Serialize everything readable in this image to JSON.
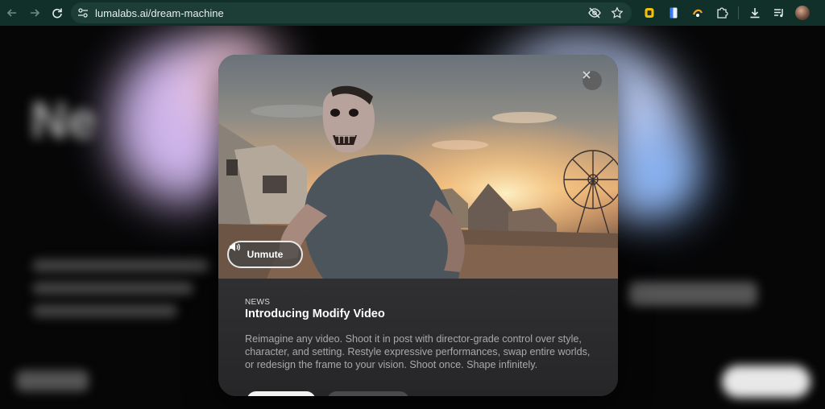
{
  "browser": {
    "url": "lumalabs.ai/dream-machine",
    "icons": [
      "back-icon",
      "forward-icon",
      "reload-icon",
      "site-info-icon",
      "eye-off-icon",
      "star-icon",
      "extension-icon",
      "puzzle-icon",
      "download-icon",
      "media-icon",
      "profile-avatar"
    ]
  },
  "modal": {
    "kicker": "NEWS",
    "title": "Introducing Modify Video",
    "description": "Reimagine any video. Shoot it in post with director-grade control over style, character, and setting. Restyle expressive performances, swap entire worlds, or redesign the frame to your vision. Shoot once. Shape infinitely.",
    "unmute_label": "Unmute"
  },
  "colors": {
    "chrome": "#11302a",
    "omnibox": "#1d3d37",
    "modal_body": "#2a2a2c",
    "accent_yellow": "#f2c200"
  }
}
